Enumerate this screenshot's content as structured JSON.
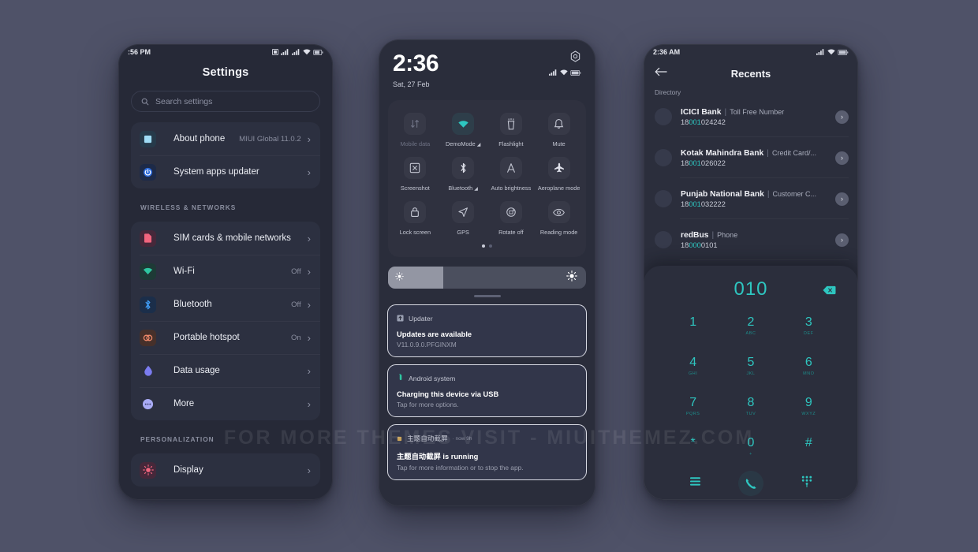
{
  "watermark": "FOR MORE THEMES VISIT - MIUITHEMEZ.COM",
  "colors": {
    "background": "#4f5268",
    "accent_teal": "#2ec6c0",
    "card": "#2c3040",
    "screen": "#262937"
  },
  "phone_settings": {
    "status_time": ":56 PM",
    "title": "Settings",
    "search": {
      "placeholder": "Search settings",
      "icon": "search-icon"
    },
    "top_items": [
      {
        "label": "About phone",
        "value": "MIUI Global 11.0.2",
        "icon": "about-phone-icon",
        "icon_color": "#9fdcf5"
      },
      {
        "label": "System apps updater",
        "value": "",
        "icon": "power-updater-icon",
        "icon_color": "#2d6bdb"
      }
    ],
    "sections": [
      {
        "header": "WIRELESS & NETWORKS",
        "items": [
          {
            "label": "SIM cards & mobile networks",
            "value": "",
            "icon": "sim-card-icon",
            "icon_color": "#f2657e"
          },
          {
            "label": "Wi-Fi",
            "value": "Off",
            "icon": "wifi-icon",
            "icon_color": "#2ec6a0"
          },
          {
            "label": "Bluetooth",
            "value": "Off",
            "icon": "bluetooth-icon",
            "icon_color": "#3f9cf5"
          },
          {
            "label": "Portable hotspot",
            "value": "On",
            "icon": "hotspot-icon",
            "icon_color": "#f28a6b"
          },
          {
            "label": "Data usage",
            "value": "",
            "icon": "data-usage-icon",
            "icon_color": "#7b7cf0"
          },
          {
            "label": "More",
            "value": "",
            "icon": "more-icon",
            "icon_color": "#8e90f2"
          }
        ]
      },
      {
        "header": "PERSONALIZATION",
        "items": [
          {
            "label": "Display",
            "value": "",
            "icon": "display-brightness-icon",
            "icon_color": "#f2657e"
          }
        ]
      }
    ]
  },
  "phone_quicksettings": {
    "time": "2:36",
    "date": "Sat, 27 Feb",
    "settings_gear": "gear-icon",
    "tiles": [
      {
        "label": "Mobile data",
        "icon": "mobile-data-icon",
        "state": "off"
      },
      {
        "label": "DemoMode",
        "icon": "wifi-icon",
        "state": "on",
        "caret": true
      },
      {
        "label": "Flashlight",
        "icon": "flashlight-icon",
        "state": "off"
      },
      {
        "label": "Mute",
        "icon": "bell-icon",
        "state": "off"
      },
      {
        "label": "Screenshot",
        "icon": "screenshot-icon",
        "state": "off"
      },
      {
        "label": "Bluetooth",
        "icon": "bluetooth-icon",
        "state": "off",
        "caret": true
      },
      {
        "label": "Auto brightness",
        "icon": "auto-brightness-icon",
        "state": "off"
      },
      {
        "label": "Aeroplane mode",
        "icon": "airplane-icon",
        "state": "off"
      },
      {
        "label": "Lock screen",
        "icon": "lock-icon",
        "state": "off"
      },
      {
        "label": "GPS",
        "icon": "gps-icon",
        "state": "off"
      },
      {
        "label": "Rotate off",
        "icon": "rotate-icon",
        "state": "off"
      },
      {
        "label": "Reading mode",
        "icon": "eye-icon",
        "state": "off"
      }
    ],
    "page_dots": {
      "count": 2,
      "active": 0
    },
    "brightness": {
      "level_percent": 28,
      "low_icon": "brightness-low-icon",
      "high_icon": "brightness-high-icon"
    },
    "notifications": [
      {
        "app": "Updater",
        "app_icon": "updater-icon",
        "sub": "",
        "title": "Updates are available",
        "body": "V11.0.9.0.PFGINXM"
      },
      {
        "app": "Android system",
        "app_icon": "android-icon",
        "sub": "",
        "title": "Charging this device via USB",
        "body": "Tap for more options."
      },
      {
        "app": "主题自动截屏",
        "app_icon": "app-dot-icon",
        "sub": "· now 9h",
        "title": "主题自动截屏 is running",
        "body": "Tap for more information or to stop the app."
      }
    ]
  },
  "phone_dialer": {
    "status_time": "2:36 AM",
    "back_icon": "back-arrow-icon",
    "title": "Recents",
    "directory_label": "Directory",
    "contacts": [
      {
        "name": "ICICI Bank",
        "type": "Toll Free Number",
        "number_prefix": "18",
        "number_match": "001",
        "number_suffix": "024242"
      },
      {
        "name": "Kotak Mahindra Bank",
        "type": "Credit Card/...",
        "number_prefix": "18",
        "number_match": "001",
        "number_suffix": "026022"
      },
      {
        "name": "Punjab National Bank",
        "type": "Customer C...",
        "number_prefix": "18",
        "number_match": "001",
        "number_suffix": "032222"
      },
      {
        "name": "redBus",
        "type": "Phone",
        "number_prefix": "18",
        "number_match": "000",
        "number_suffix": "0101"
      }
    ],
    "dialed_number": "010",
    "backspace_icon": "backspace-icon",
    "keys": [
      {
        "digit": "1",
        "letters": ""
      },
      {
        "digit": "2",
        "letters": "ABC"
      },
      {
        "digit": "3",
        "letters": "DEF"
      },
      {
        "digit": "4",
        "letters": "GHI"
      },
      {
        "digit": "5",
        "letters": "JKL"
      },
      {
        "digit": "6",
        "letters": "MNO"
      },
      {
        "digit": "7",
        "letters": "PQRS"
      },
      {
        "digit": "8",
        "letters": "TUV"
      },
      {
        "digit": "9",
        "letters": "WXYZ"
      },
      {
        "digit": "*",
        "letters": ""
      },
      {
        "digit": "0",
        "letters": "+"
      },
      {
        "digit": "#",
        "letters": ""
      }
    ],
    "nav": [
      {
        "icon": "menu-icon",
        "name": "menu-button"
      },
      {
        "icon": "call-icon",
        "name": "call-button"
      },
      {
        "icon": "keypad-icon",
        "name": "keypad-button"
      }
    ]
  }
}
